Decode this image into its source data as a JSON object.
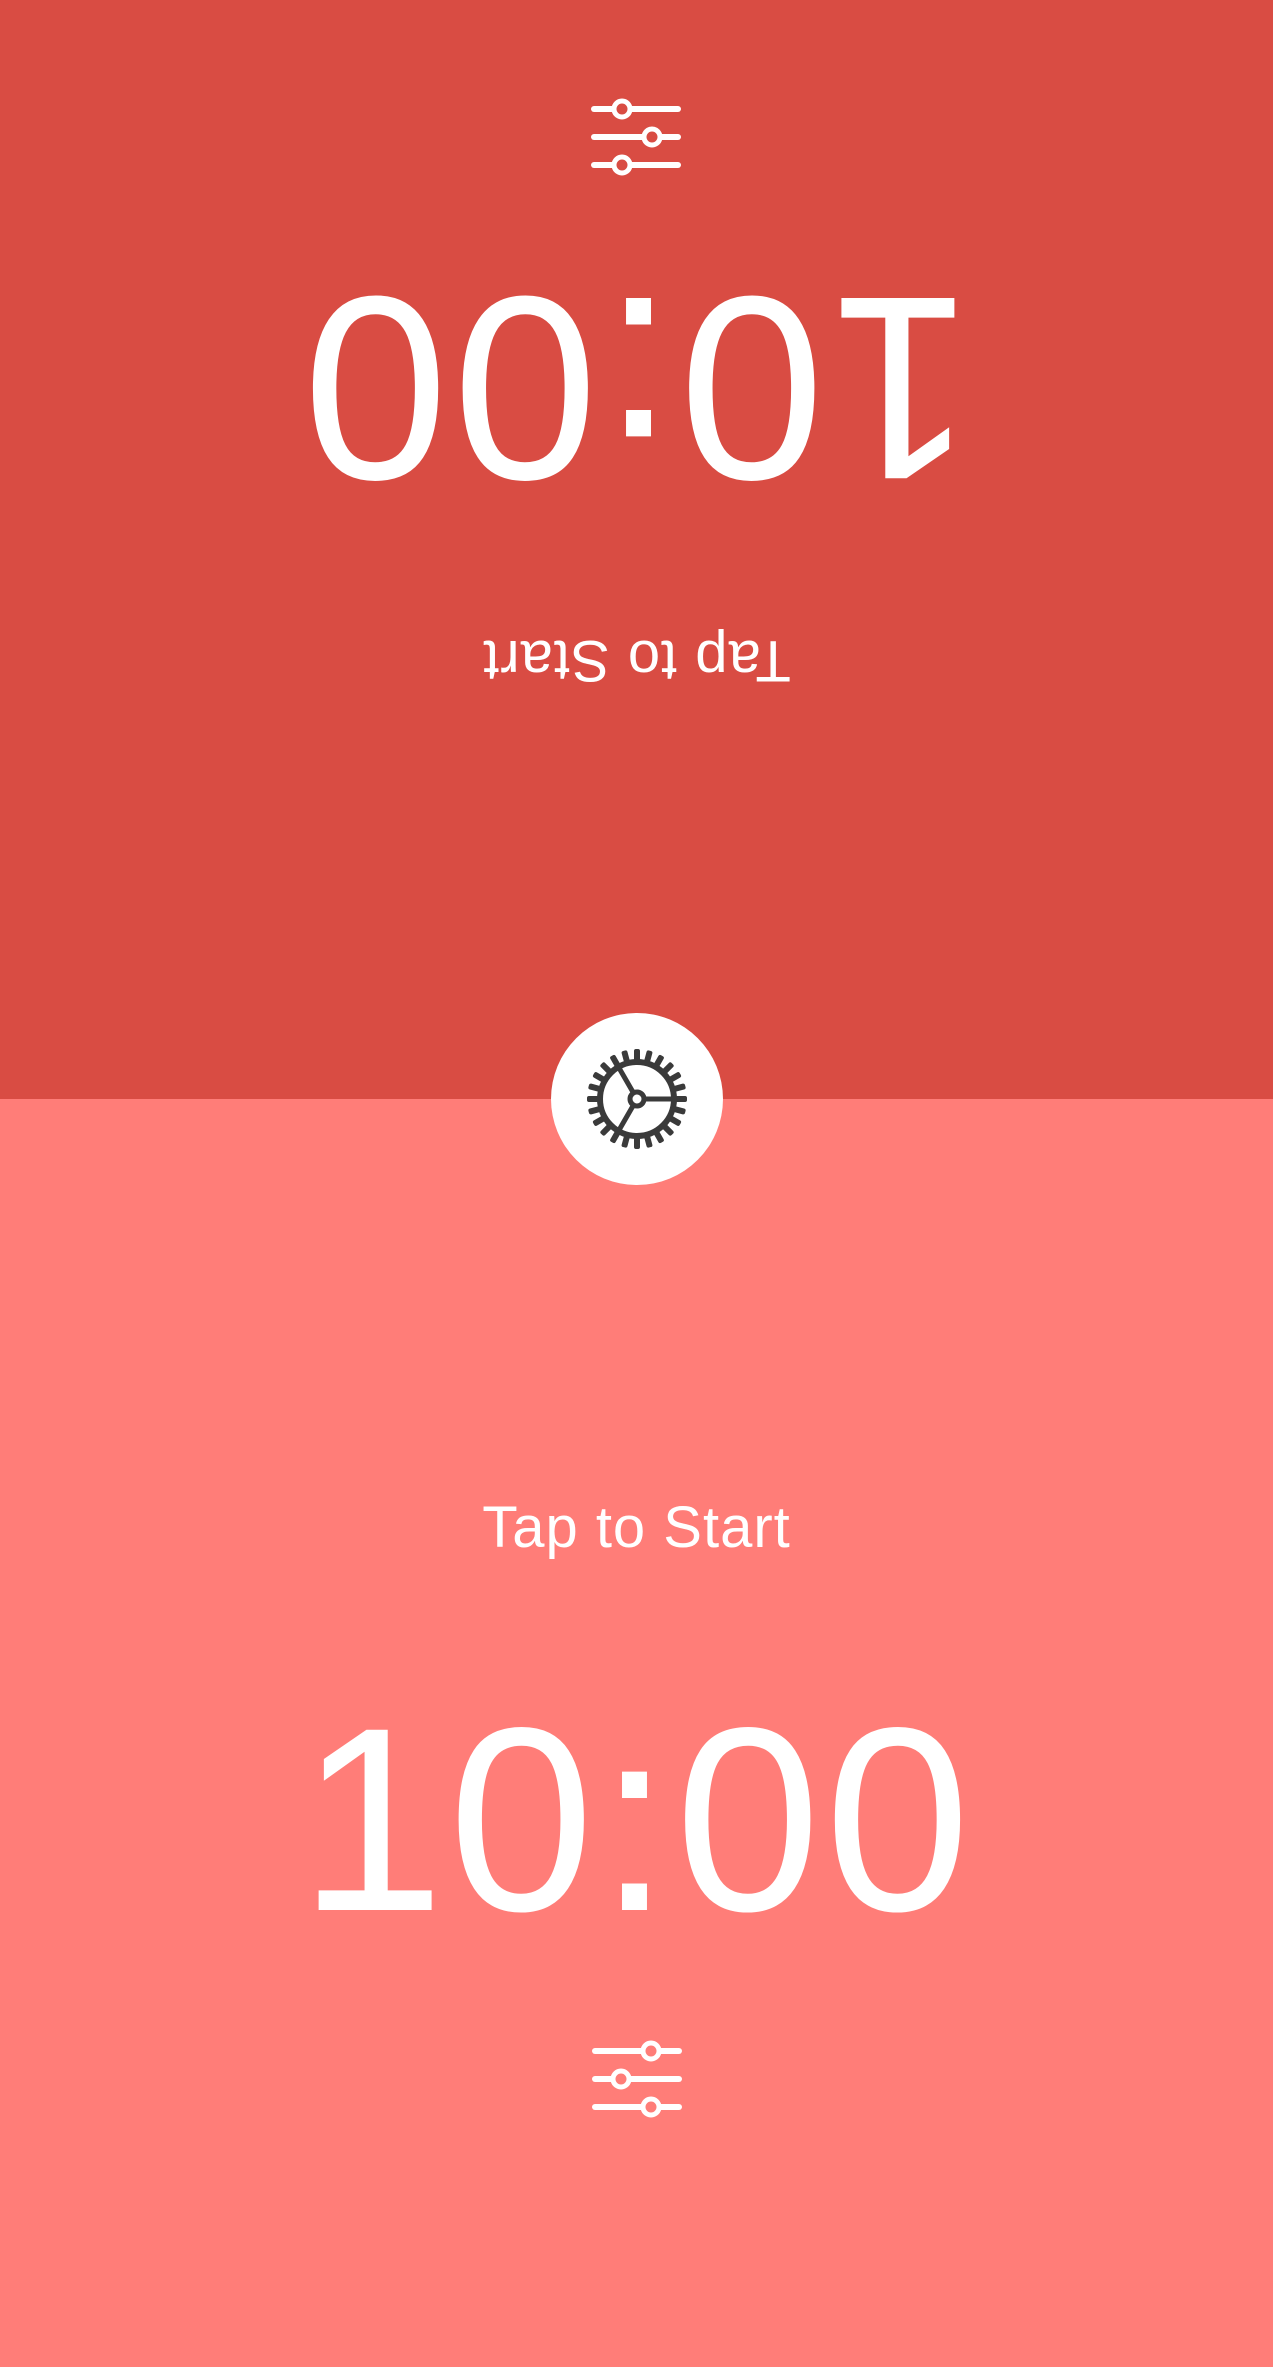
{
  "top_player": {
    "time": "10:00",
    "prompt": "Tap to Start",
    "background": "#d94c43",
    "adjust_icon": "sliders-icon"
  },
  "bottom_player": {
    "time": "10:00",
    "prompt": "Tap to Start",
    "background": "#ff7d78",
    "adjust_icon": "sliders-icon"
  },
  "settings": {
    "icon": "gear-icon",
    "background": "#ffffff",
    "icon_color": "#3a3a3a"
  }
}
